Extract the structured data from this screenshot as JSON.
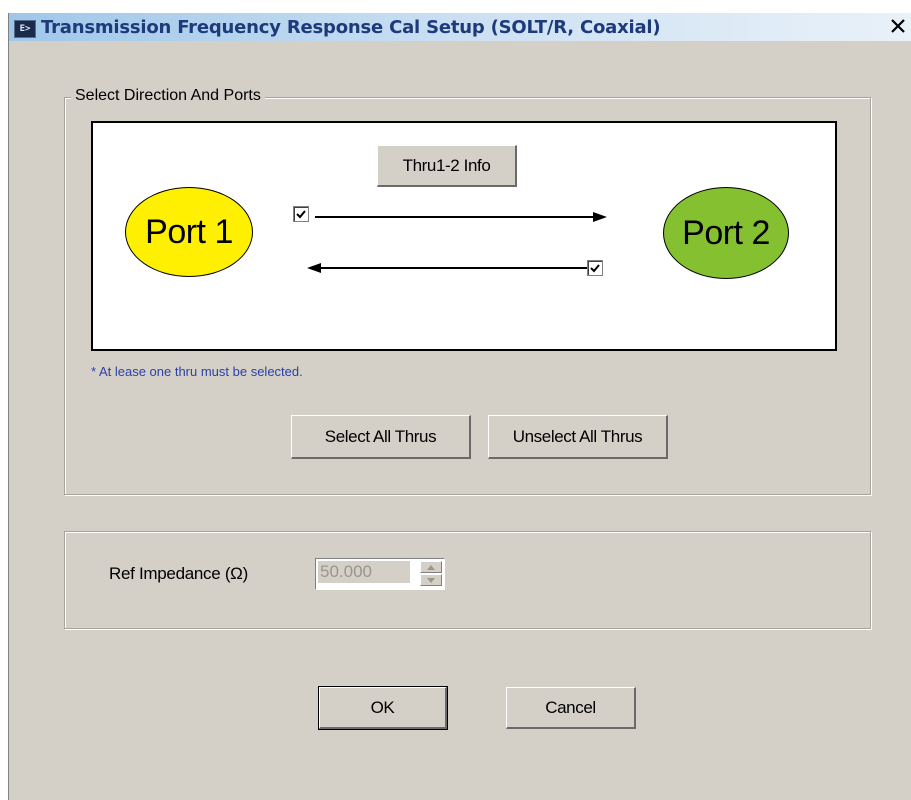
{
  "window": {
    "title": "Transmission Frequency Response Cal Setup (SOLT/R, Coaxial)",
    "icon": "app-window-icon",
    "close_label": "✕"
  },
  "direction_group": {
    "legend": "Select Direction And Ports",
    "thru_info_label": "Thru1-2 Info",
    "port1_label": "Port 1",
    "port2_label": "Port 2",
    "port1_color": "#ffef00",
    "port2_color": "#84c030",
    "forward_thru_checked": true,
    "reverse_thru_checked": true,
    "note": "* At lease one thru must be selected.",
    "select_all_label": "Select All Thrus",
    "unselect_all_label": "Unselect All Thrus"
  },
  "impedance_group": {
    "label": "Ref Impedance (Ω)",
    "value": "50.000"
  },
  "footer": {
    "ok_label": "OK",
    "cancel_label": "Cancel"
  }
}
